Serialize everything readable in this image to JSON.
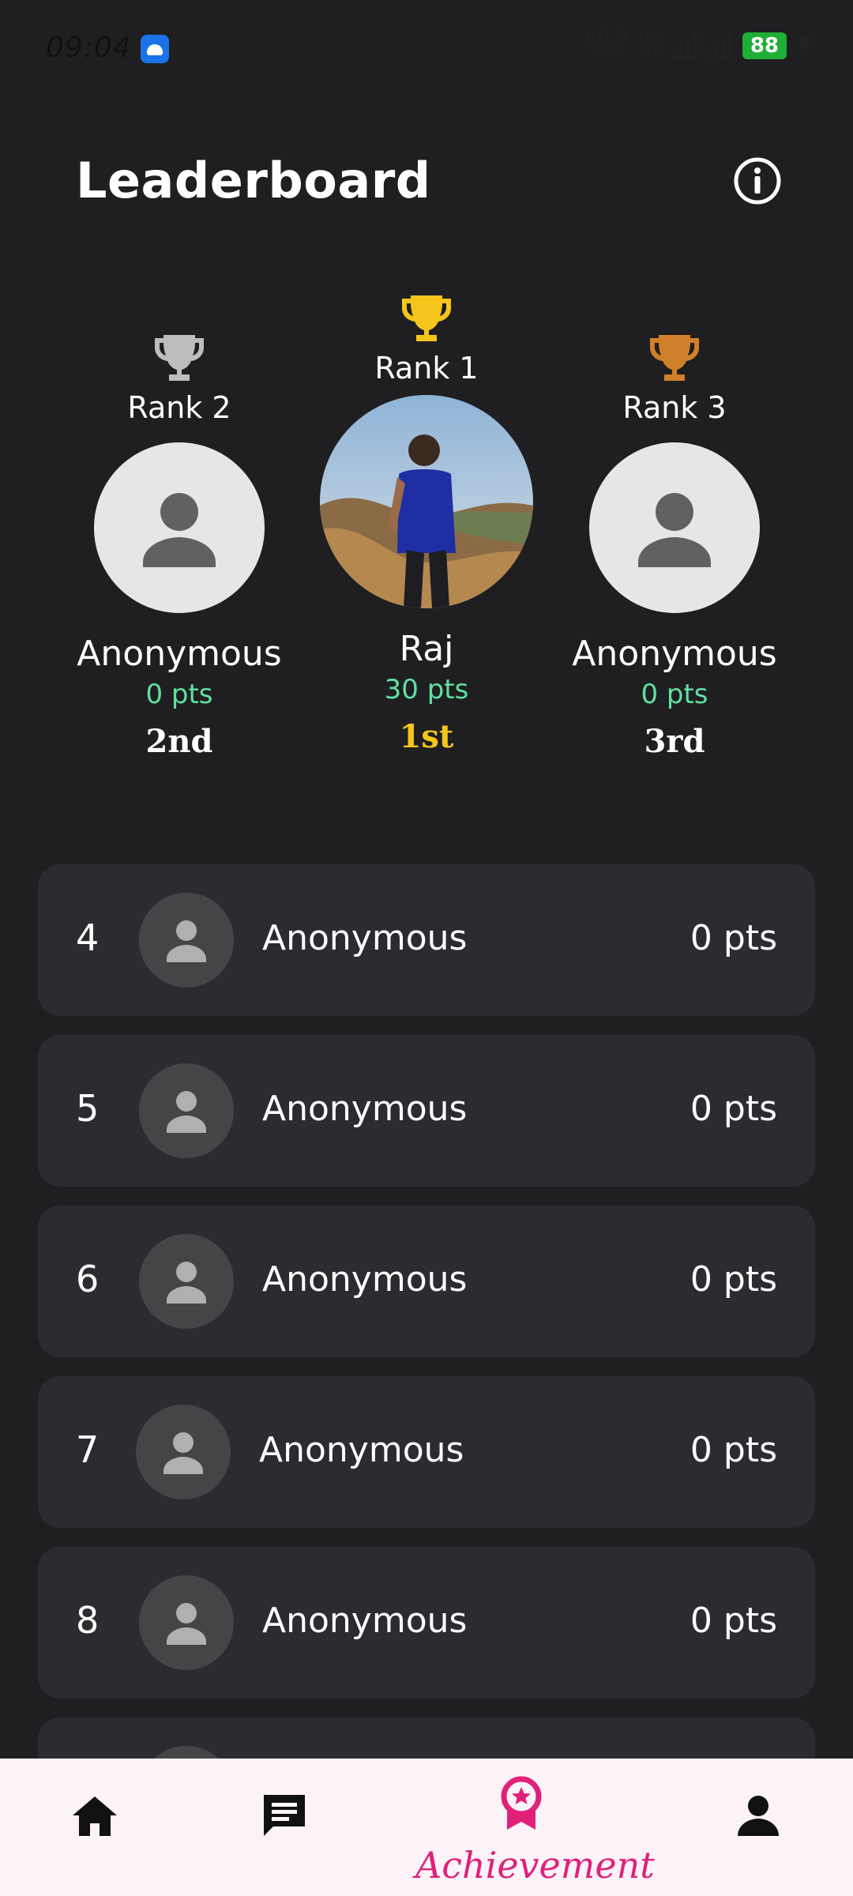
{
  "status_bar": {
    "time": "09:04",
    "net_speed": "60.0",
    "net_unit": "KB/S",
    "net_type_1": "Vo",
    "net_type_2": "LTE",
    "battery": "88"
  },
  "header": {
    "title": "Leaderboard",
    "info_icon": "info-icon"
  },
  "podium": {
    "first": {
      "rank_label": "Rank 1",
      "name": "Raj",
      "points": "30 pts",
      "place": "1st",
      "trophy_color": "#f5c51b"
    },
    "second": {
      "rank_label": "Rank 2",
      "name": "Anonymous",
      "points": "0 pts",
      "place": "2nd",
      "trophy_color": "#bdbdbd"
    },
    "third": {
      "rank_label": "Rank 3",
      "name": "Anonymous",
      "points": "0 pts",
      "place": "3rd",
      "trophy_color": "#d1802a"
    }
  },
  "list": [
    {
      "rank": "4",
      "name": "Anonymous",
      "points": "0 pts"
    },
    {
      "rank": "5",
      "name": "Anonymous",
      "points": "0 pts"
    },
    {
      "rank": "6",
      "name": "Anonymous",
      "points": "0 pts"
    },
    {
      "rank": "7",
      "name": "Anonymous",
      "points": "0 pts"
    },
    {
      "rank": "8",
      "name": "Anonymous",
      "points": "0 pts"
    }
  ],
  "bottom_nav": {
    "items": [
      "home-icon",
      "chat-icon",
      "achievement-icon",
      "profile-icon"
    ],
    "active_label": "Achievement",
    "active_color": "#e0217a"
  },
  "colors": {
    "background": "#1f1f21",
    "card": "#2b2c30",
    "points_green": "#5fe0a0",
    "gold": "#f5c51b"
  }
}
